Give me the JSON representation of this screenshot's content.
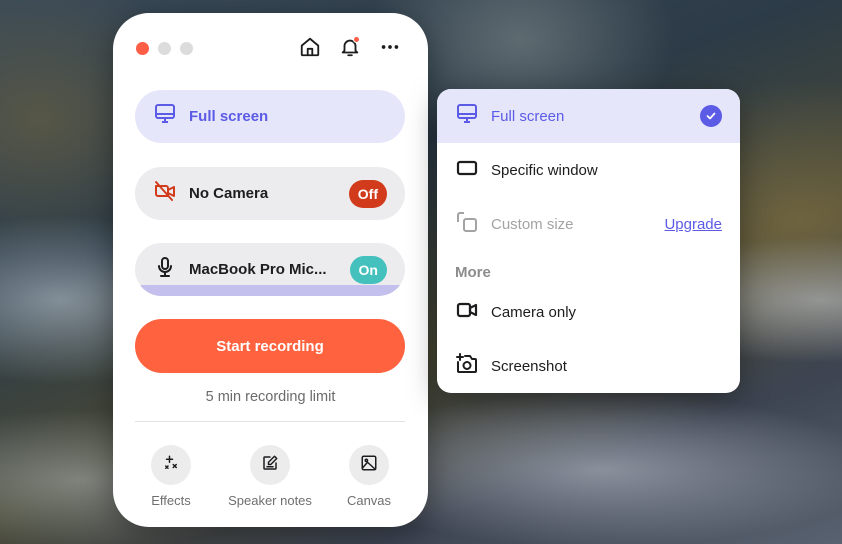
{
  "window": {
    "traffic_lights": [
      "close",
      "minimize",
      "maximize"
    ],
    "top_icons": [
      {
        "name": "home-icon"
      },
      {
        "name": "bell-icon",
        "has_notification": true
      },
      {
        "name": "more-icon"
      }
    ]
  },
  "recorder": {
    "source": {
      "label": "Full screen",
      "icon": "monitor-icon"
    },
    "camera": {
      "label": "No Camera",
      "icon": "camera-off-icon",
      "toggle": "Off"
    },
    "microphone": {
      "label": "MacBook Pro Mic...",
      "icon": "microphone-icon",
      "toggle": "On",
      "level_percent": 100
    },
    "start_label": "Start recording",
    "limit_text": "5 min recording limit",
    "tools": [
      {
        "label": "Effects",
        "icon": "sparkles-icon"
      },
      {
        "label": "Speaker notes",
        "icon": "edit-note-icon"
      },
      {
        "label": "Canvas",
        "icon": "image-icon"
      }
    ]
  },
  "source_menu": {
    "items": [
      {
        "label": "Full screen",
        "icon": "monitor-icon",
        "selected": true
      },
      {
        "label": "Specific window",
        "icon": "window-icon"
      },
      {
        "label": "Custom size",
        "icon": "custom-size-icon",
        "disabled": true,
        "action": "Upgrade"
      }
    ],
    "more_header": "More",
    "more_items": [
      {
        "label": "Camera only",
        "icon": "video-camera-icon"
      },
      {
        "label": "Screenshot",
        "icon": "screenshot-icon"
      }
    ]
  },
  "colors": {
    "accent": "#5b5be6",
    "accent_bg": "#e6e6fb",
    "record": "#ff623e",
    "off": "#d23a1c",
    "on": "#45c1bd",
    "level": "#c3c0ee"
  }
}
